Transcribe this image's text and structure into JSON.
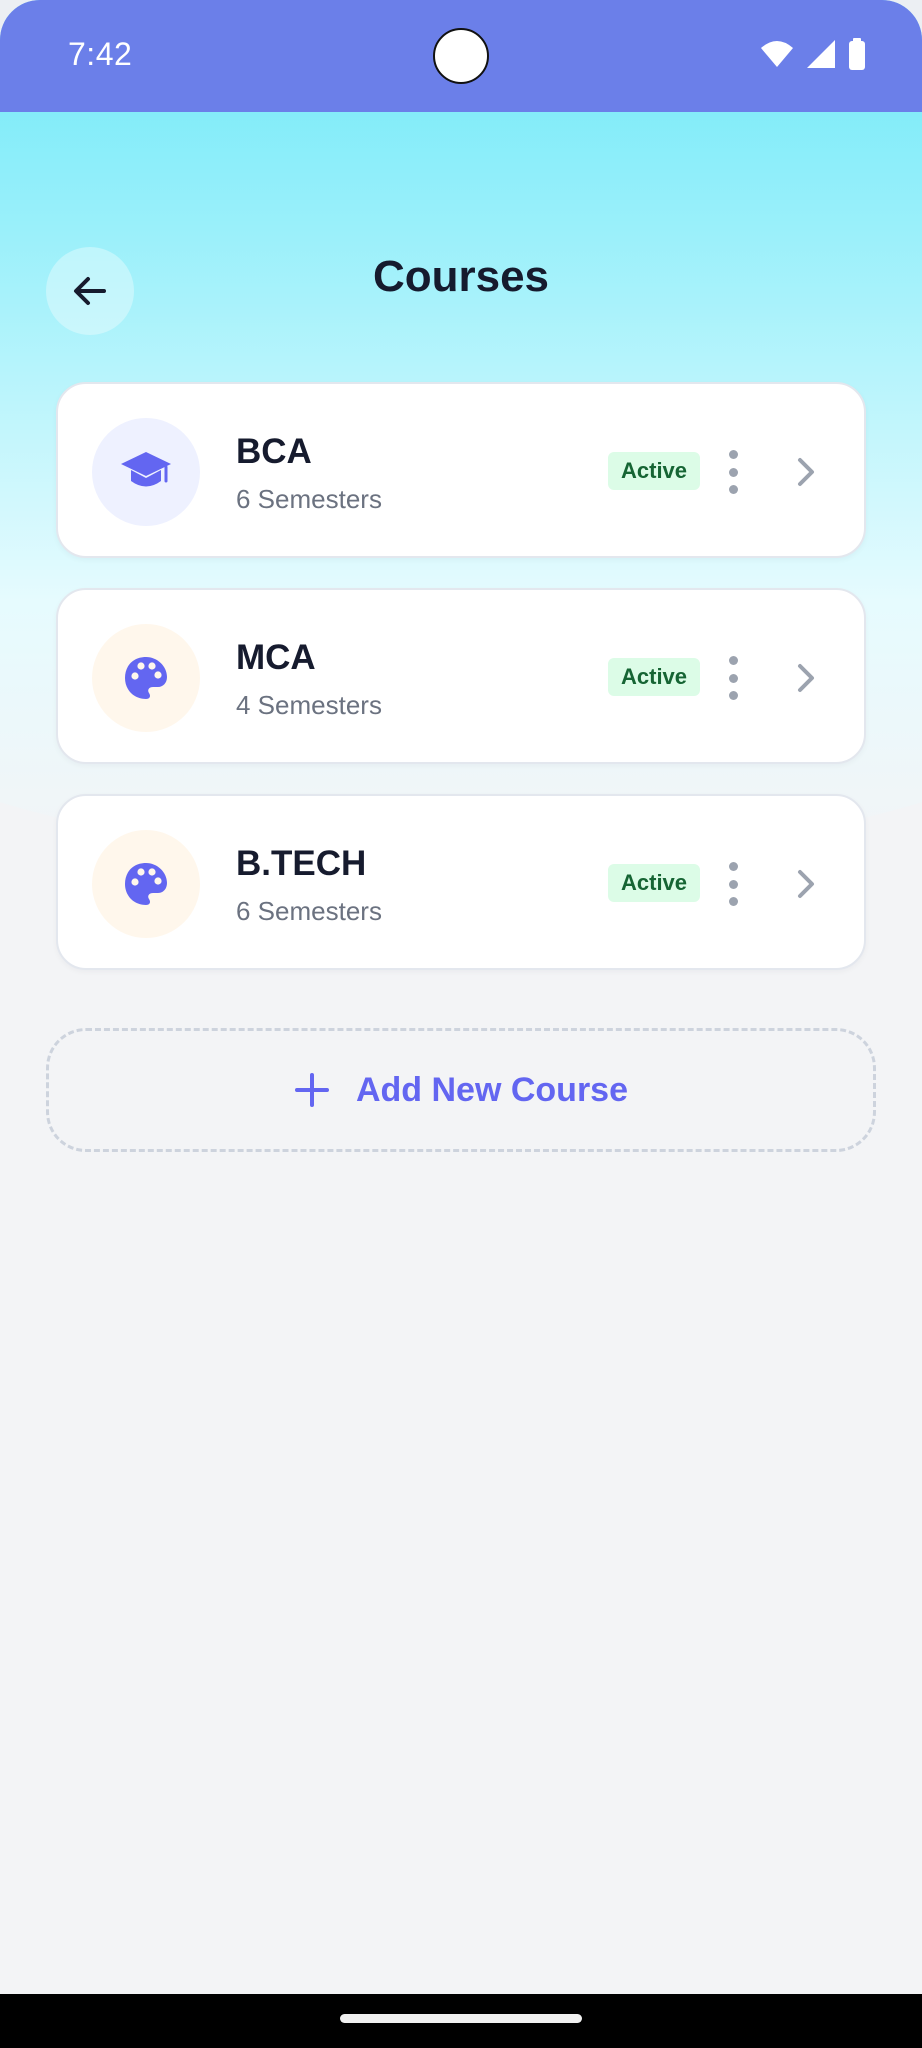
{
  "status_bar": {
    "time": "7:42"
  },
  "header": {
    "title": "Courses"
  },
  "courses": [
    {
      "name": "BCA",
      "semesters": "6 Semesters",
      "status": "Active",
      "icon": "graduation-cap-icon",
      "icon_bg": "#eef1ff"
    },
    {
      "name": "MCA",
      "semesters": "4 Semesters",
      "status": "Active",
      "icon": "palette-icon",
      "icon_bg": "#fff7ec"
    },
    {
      "name": "B.TECH",
      "semesters": "6 Semesters",
      "status": "Active",
      "icon": "palette-icon",
      "icon_bg": "#fff7ec"
    }
  ],
  "add_button": {
    "label": "Add New Course"
  },
  "colors": {
    "accent": "#6366f1",
    "status_bar": "#6b7fe9",
    "badge_bg": "#dcfce7",
    "badge_text": "#166534"
  }
}
